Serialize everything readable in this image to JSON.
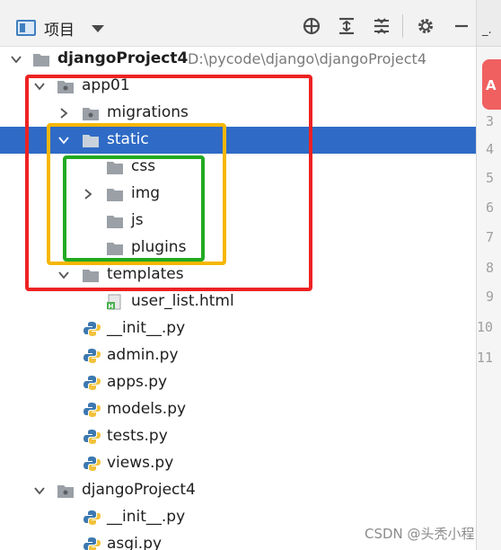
{
  "toolbar": {
    "title": "项目",
    "icons": [
      "project-view-icon",
      "chevron-down-icon",
      "locate-target-icon",
      "expand-all-icon",
      "collapse-all-icon",
      "gear-icon",
      "minimize-icon"
    ]
  },
  "editor_strip": {
    "tab_fragment": "_.",
    "badge": "A",
    "line_numbers": [
      "3",
      "4",
      "5",
      "6",
      "7",
      "8",
      "9",
      "10",
      "11"
    ]
  },
  "tree": {
    "rows": [
      {
        "label": "djangoProject4",
        "path": "D:\\pycode\\django\\djangoProject4",
        "icon": "folder-icon",
        "expanded": true
      },
      {
        "label": "app01",
        "icon": "package-icon",
        "expanded": true
      },
      {
        "label": "migrations",
        "icon": "package-icon",
        "expanded": false
      },
      {
        "label": "static",
        "icon": "folder-icon",
        "expanded": true,
        "selected": true
      },
      {
        "label": "css",
        "icon": "folder-icon"
      },
      {
        "label": "img",
        "icon": "folder-icon",
        "expanded": false
      },
      {
        "label": "js",
        "icon": "folder-icon"
      },
      {
        "label": "plugins",
        "icon": "folder-icon"
      },
      {
        "label": "templates",
        "icon": "folder-icon",
        "expanded": true
      },
      {
        "label": "user_list.html",
        "icon": "html-file-icon"
      },
      {
        "label": "__init__.py",
        "icon": "python-file-icon"
      },
      {
        "label": "admin.py",
        "icon": "python-file-icon"
      },
      {
        "label": "apps.py",
        "icon": "python-file-icon"
      },
      {
        "label": "models.py",
        "icon": "python-file-icon"
      },
      {
        "label": "tests.py",
        "icon": "python-file-icon"
      },
      {
        "label": "views.py",
        "icon": "python-file-icon"
      },
      {
        "label": "djangoProject4",
        "icon": "package-icon",
        "expanded": true
      },
      {
        "label": "__init__.py",
        "icon": "python-file-icon"
      },
      {
        "label": "asgi.py",
        "icon": "python-file-icon"
      }
    ]
  },
  "annotations": {
    "colors": {
      "outer": "#ee2222",
      "middle": "#f5b700",
      "inner": "#22aa22"
    }
  },
  "watermark": "CSDN @头秃小程",
  "colors": {
    "selection": "#2f6bc6",
    "folder": "#9aa0a6",
    "python_blue": "#3c78b0",
    "python_yellow": "#f2c23b"
  }
}
